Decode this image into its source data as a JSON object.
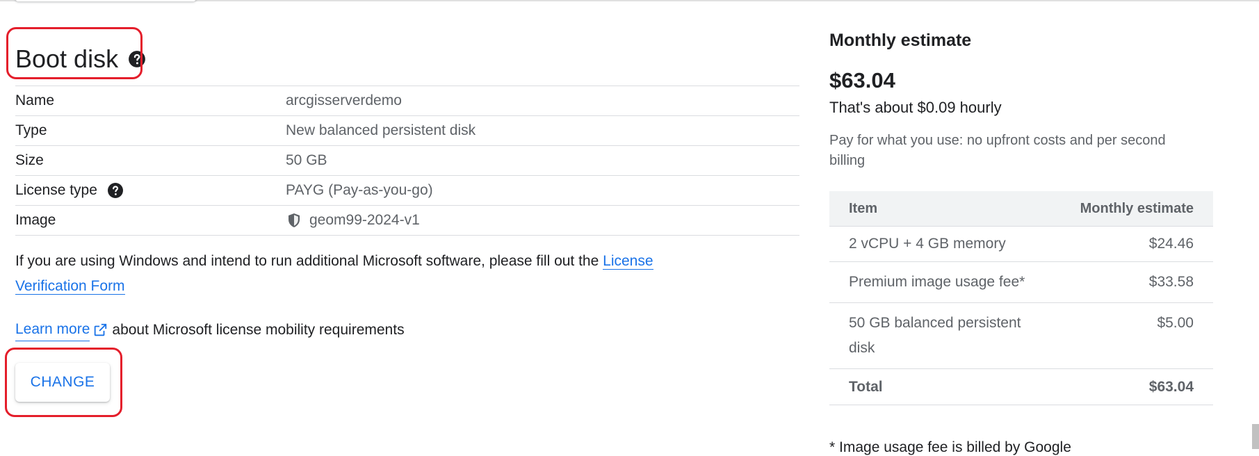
{
  "boot_disk": {
    "title": "Boot disk",
    "rows": [
      {
        "key": "Name",
        "value": "arcgisserverdemo"
      },
      {
        "key": "Type",
        "value": "New balanced persistent disk"
      },
      {
        "key": "Size",
        "value": "50 GB"
      },
      {
        "key": "License type",
        "value": "PAYG (Pay-as-you-go)"
      },
      {
        "key": "Image",
        "value": "geom99-2024-v1"
      }
    ],
    "notice_text": "If you are using Windows and intend to run additional Microsoft software, please fill out the",
    "license_link": "License Verification Form",
    "learn_more_link": "Learn more",
    "learn_more_suffix": "about Microsoft license mobility requirements",
    "change_button": "CHANGE"
  },
  "estimate": {
    "heading": "Monthly estimate",
    "amount": "$63.04",
    "hourly": "That's about $0.09 hourly",
    "note": "Pay for what you use: no upfront costs and per second billing",
    "table_header": {
      "item": "Item",
      "cost": "Monthly estimate"
    },
    "items": [
      {
        "name": "2 vCPU + 4 GB memory",
        "cost": "$24.46"
      },
      {
        "name": "Premium image usage fee*",
        "cost": "$33.58"
      },
      {
        "name": "50 GB balanced persistent disk",
        "cost": "$5.00"
      }
    ],
    "total": {
      "label": "Total",
      "cost": "$63.04"
    },
    "footnote": "* Image usage fee is billed by Google"
  },
  "colors": {
    "accent": "#1a73e8",
    "highlight_box": "#e41e2b"
  },
  "icons": [
    "help-icon",
    "shield-icon",
    "external-link-icon"
  ]
}
